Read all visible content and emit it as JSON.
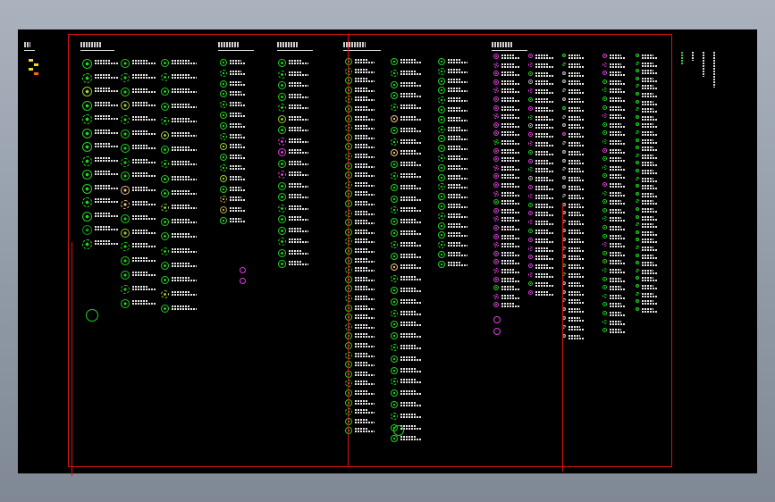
{
  "drawing": {
    "background": "#000000",
    "frame_color": "#dd1111",
    "text_color": "#e8e8e8",
    "symbol_colors": {
      "green": "#1fd21f",
      "dark_green": "#0f8f0f",
      "yellow_green": "#9acd32",
      "olive": "#b5a642",
      "magenta": "#e040e0",
      "tan": "#f0c080",
      "grey": "#bbbbbb"
    },
    "legend_marks": [
      "#e8e020",
      "#e8e020",
      "#e8e020",
      "#ff6a00"
    ],
    "side_notes": 4,
    "columns": [
      {
        "id": "col1",
        "symbols": [
          "green",
          "green",
          "yellow_green",
          "green",
          "green",
          "green",
          "green",
          "green",
          "green",
          "green",
          "green",
          "green",
          "dark_green",
          "green"
        ]
      },
      {
        "id": "col2",
        "symbols": [
          "green",
          "green",
          "green",
          "yellow_green",
          "green",
          "green",
          "green",
          "green",
          "green",
          "tan",
          "tan",
          "green",
          "yellow_green",
          "green",
          "green",
          "green",
          "green",
          "green"
        ]
      },
      {
        "id": "col3",
        "symbols": [
          "green",
          "green",
          "green",
          "green",
          "green",
          "yellow_green",
          "green",
          "green",
          "green",
          "green",
          "yellow_green",
          "green",
          "green",
          "green",
          "green",
          "green",
          "yellow_green",
          "green"
        ]
      },
      {
        "id": "col4",
        "symbols": [
          "green",
          "green",
          "green",
          "green",
          "green",
          "green",
          "green",
          "green",
          "yellow_green",
          "green",
          "green",
          "yellow_green",
          "green",
          "olive",
          "olive",
          "green"
        ]
      },
      {
        "id": "col5",
        "symbols": [
          "green",
          "green",
          "green",
          "green",
          "green",
          "yellow_green",
          "green",
          "magenta",
          "magenta",
          "green",
          "magenta",
          "green",
          "green",
          "green",
          "green",
          "green",
          "green",
          "green",
          "green"
        ]
      },
      {
        "id": "col6",
        "symbols": [
          "green",
          "green",
          "green",
          "green",
          "green",
          "green",
          "green",
          "green",
          "green",
          "green",
          "green",
          "green",
          "green",
          "green",
          "green",
          "green",
          "green",
          "green",
          "green",
          "green",
          "green",
          "green",
          "green",
          "green",
          "green",
          "green",
          "green",
          "green",
          "green",
          "green",
          "green",
          "green",
          "green",
          "green",
          "green",
          "green",
          "green",
          "green",
          "green",
          "green"
        ]
      },
      {
        "id": "col7",
        "symbols": [
          "green",
          "green",
          "green",
          "green",
          "green",
          "tan",
          "green",
          "green",
          "tan",
          "green",
          "green",
          "green",
          "green",
          "green",
          "green",
          "green",
          "green",
          "green",
          "tan",
          "green",
          "green",
          "green",
          "green",
          "green",
          "green",
          "green",
          "green",
          "green",
          "green",
          "green",
          "green",
          "green",
          "green",
          "green"
        ]
      },
      {
        "id": "col8",
        "symbols": [
          "green",
          "green",
          "green",
          "green",
          "green",
          "green",
          "green",
          "green",
          "green",
          "green",
          "green",
          "green",
          "green",
          "green",
          "green",
          "green",
          "green",
          "green",
          "green",
          "green",
          "green",
          "green"
        ]
      },
      {
        "id": "col9",
        "symbols": [
          "magenta",
          "magenta",
          "magenta",
          "magenta",
          "magenta",
          "magenta",
          "magenta",
          "magenta",
          "magenta",
          "magenta",
          "green",
          "magenta",
          "magenta",
          "magenta",
          "magenta",
          "magenta",
          "magenta",
          "green",
          "magenta",
          "magenta",
          "magenta",
          "magenta",
          "magenta",
          "magenta",
          "magenta",
          "magenta",
          "magenta",
          "green",
          "magenta",
          "magenta"
        ]
      },
      {
        "id": "col10",
        "symbols": [
          "magenta",
          "magenta",
          "green",
          "grey",
          "magenta",
          "green",
          "magenta",
          "green",
          "grey",
          "magenta",
          "magenta",
          "green",
          "magenta",
          "green",
          "grey",
          "magenta",
          "magenta",
          "green",
          "magenta",
          "magenta",
          "green",
          "magenta",
          "magenta",
          "magenta",
          "magenta",
          "magenta",
          "green",
          "magenta"
        ]
      },
      {
        "id": "col11",
        "symbols": [
          "green",
          "green",
          "grey",
          "grey",
          "grey",
          "grey",
          "green",
          "grey",
          "grey",
          "magenta",
          "grey",
          "grey",
          "grey",
          "grey",
          "grey",
          "grey",
          "grey",
          "grey",
          "grey",
          "grey",
          "grey",
          "grey",
          "grey",
          "grey",
          "green",
          "green",
          "grey",
          "grey",
          "grey",
          "grey",
          "grey",
          "grey",
          "grey"
        ]
      },
      {
        "id": "col12",
        "symbols": [
          "magenta",
          "magenta",
          "magenta",
          "green",
          "green",
          "green",
          "green",
          "magenta",
          "green",
          "green",
          "green",
          "magenta",
          "green",
          "green",
          "green",
          "magenta",
          "green",
          "green",
          "green",
          "green",
          "green",
          "green",
          "magenta",
          "green",
          "green",
          "green",
          "green",
          "green",
          "green",
          "green",
          "green",
          "green",
          "green"
        ]
      },
      {
        "id": "col13",
        "symbols": [
          "green",
          "green",
          "green",
          "green",
          "green",
          "green",
          "green",
          "green",
          "green",
          "green",
          "green",
          "green",
          "green",
          "green",
          "green",
          "green",
          "green",
          "green",
          "green",
          "green",
          "green",
          "green",
          "green",
          "green",
          "green",
          "green",
          "green",
          "green",
          "green",
          "green",
          "green",
          "green",
          "green",
          "green"
        ]
      }
    ]
  }
}
